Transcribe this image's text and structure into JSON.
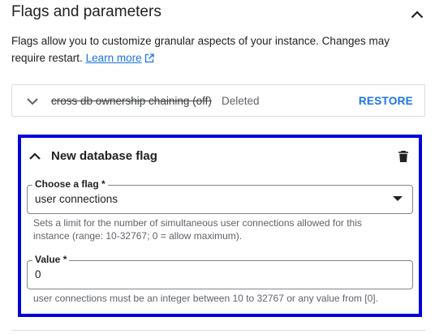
{
  "section": {
    "title": "Flags and parameters",
    "description": "Flags allow you to customize granular aspects of your instance. Changes may require restart.",
    "learn_more": "Learn more"
  },
  "icons": {
    "collapse_section": "chevron-up-icon",
    "external_link": "open-in-new-icon",
    "expand_deleted": "chevron-down-icon",
    "collapse_new": "chevron-up-icon",
    "delete_flag": "trash-icon",
    "dropdown": "arrow-drop-down-icon"
  },
  "deleted_flag": {
    "name": "cross db ownership chaining (off)",
    "status": "Deleted",
    "action": "RESTORE"
  },
  "new_flag": {
    "title": "New database flag",
    "flag_select": {
      "label": "Choose a flag *",
      "value": "user connections",
      "hint": "Sets a limit for the number of simultaneous user connections allowed for this instance (range: 10-32767; 0 = allow maximum)."
    },
    "value_input": {
      "label": "Value *",
      "value": "0",
      "hint": "user connections must be an integer between 10 to 32767 or any value from [0]."
    }
  },
  "colors": {
    "accent": "#1a73e8",
    "highlight_border": "#0000d8",
    "text": "#202124",
    "secondary_text": "#5f6368"
  }
}
